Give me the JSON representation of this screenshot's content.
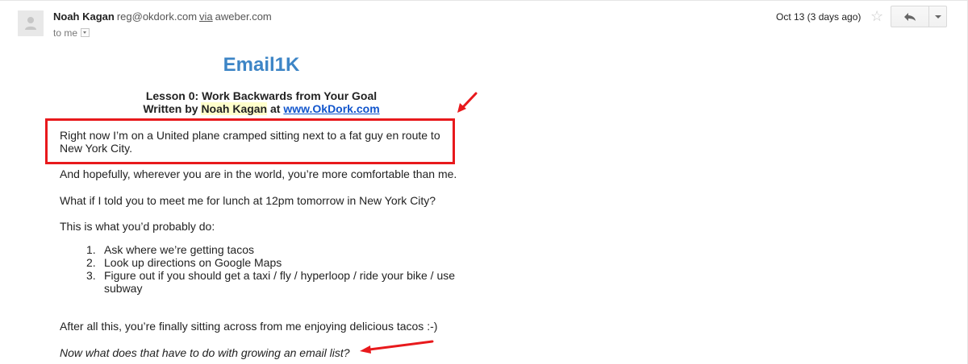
{
  "header": {
    "sender_name": "Noah Kagan",
    "sender_email": "reg@okdork.com",
    "via_label": "via",
    "via_domain": "aweber.com",
    "to_label": "to me",
    "date": "Oct 13 (3 days ago)",
    "icons": {
      "avatar": "person-silhouette-icon",
      "star": "star-outline-icon",
      "reply": "reply-arrow-icon",
      "more": "chevron-down-icon",
      "to_toggle": "dropdown-arrow-icon"
    }
  },
  "email": {
    "title": "Email1K",
    "lesson_title": "Lesson 0: Work Backwards from Your Goal",
    "written_by_prefix": "Written by",
    "author": "Noah Kagan",
    "at_word": "at",
    "website": "www.OkDork.com",
    "paragraphs": [
      "Right now I’m on a United plane cramped sitting next to a fat guy en route to New York City.",
      "And hopefully, wherever you are in the world, you’re more comfortable than me.",
      "What if I told you to meet me for lunch at 12pm tomorrow in New York City?",
      "This is what you’d probably do:"
    ],
    "steps": [
      {
        "num": "1.",
        "text": "Ask where we’re getting tacos"
      },
      {
        "num": "2.",
        "text": "Look up directions on Google Maps"
      },
      {
        "num": "3.",
        "text": "Figure out if you should get a taxi / fly / hyperloop / ride your bike / use subway"
      }
    ],
    "closing": "After all this, you’re finally sitting across from me enjoying delicious tacos :-)",
    "question": "Now what does that have to do with growing an email list?"
  },
  "colors": {
    "title_blue": "#3d85c6",
    "link_blue": "#1155cc",
    "highlight_yellow": "#ffffcc",
    "annotation_red": "#e8191c"
  }
}
